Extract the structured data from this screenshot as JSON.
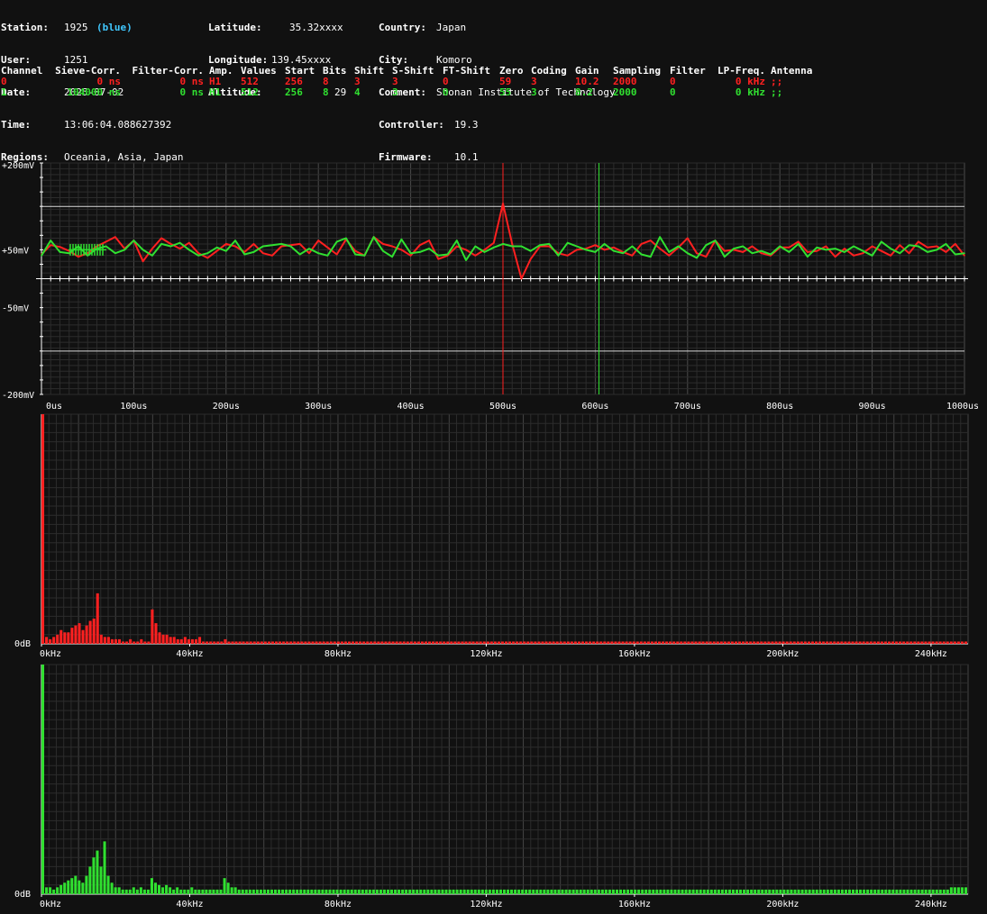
{
  "station_info": {
    "col1": [
      {
        "label": "Station:",
        "value": "1925",
        "extra": "(blue)"
      },
      {
        "label": "User:",
        "value": "1251"
      },
      {
        "label": "Date:",
        "value": "2025-07-02"
      },
      {
        "label": "Time:",
        "value": "13:06:04.088627392"
      },
      {
        "label": "Regions:",
        "value": "Oceania, Asia, Japan"
      }
    ],
    "col2": [
      {
        "label": "Latitude:",
        "value": "35.32xxxx"
      },
      {
        "label": "Longitude:",
        "value": "139.45xxxx"
      },
      {
        "label": "Altitude:",
        "value": "29"
      }
    ],
    "col3": [
      {
        "label": "Country:",
        "value": "Japan"
      },
      {
        "label": "City:",
        "value": "Komoro"
      },
      {
        "label": "Comment:",
        "value": "Shonan Institute of Technology"
      },
      {
        "label": "Controller:",
        "value": "19.3"
      },
      {
        "label": "Firmware:",
        "value": "10.1"
      }
    ]
  },
  "channel_table": {
    "headers": [
      "Channel",
      "Sieve-Corr.",
      "Filter-Corr.",
      "Amp.",
      "Values",
      "Start",
      "Bits",
      "Shift",
      "S-Shift",
      "FT-Shift",
      "Zero",
      "Coding",
      "Gain",
      "Sampling",
      "Filter",
      "LP-Freq.",
      "Antenna"
    ],
    "rows": [
      {
        "color": "#ff2020",
        "cells": [
          "0",
          "0 ns",
          "0 ns",
          "H1",
          "512",
          "256",
          "8",
          "3",
          "3",
          "0",
          "59",
          "3",
          "10.2",
          "2000",
          "0",
          "0 kHz",
          ";;"
        ]
      },
      {
        "color": "#30e030",
        "cells": [
          "1",
          "104000 ns",
          "0 ns",
          "H1",
          "512",
          "256",
          "8",
          "4",
          "3",
          "0",
          "55",
          "3",
          "8.2",
          "2000",
          "0",
          "0 kHz",
          ";;"
        ]
      }
    ]
  },
  "colors": {
    "channel0": "#ff2020",
    "channel1": "#30e030",
    "background": "#111111",
    "grid": "#3a3a3a"
  },
  "chart_data": [
    {
      "type": "line",
      "name": "waveform",
      "x_ticks": [
        "0us",
        "100us",
        "200us",
        "300us",
        "400us",
        "500us",
        "600us",
        "700us",
        "800us",
        "900us",
        "1000us"
      ],
      "y_ticks": [
        "+200mV",
        "+50mV",
        "-50mV",
        "-200mV"
      ],
      "xlim": [
        0,
        1000
      ],
      "ylim": [
        -200,
        200
      ],
      "threshold_mv": [
        125,
        -125
      ],
      "marker_us": [
        {
          "x": 500,
          "channel": 0
        },
        {
          "x": 604,
          "channel": 1
        }
      ],
      "series": [
        {
          "channel": 0,
          "x": [
            0,
            10,
            20,
            30,
            40,
            50,
            60,
            70,
            80,
            90,
            100,
            110,
            120,
            130,
            140,
            150,
            160,
            170,
            180,
            190,
            200,
            210,
            220,
            230,
            240,
            250,
            260,
            270,
            280,
            290,
            300,
            310,
            320,
            330,
            340,
            350,
            360,
            370,
            380,
            390,
            400,
            410,
            420,
            430,
            440,
            450,
            460,
            470,
            480,
            490,
            500,
            510,
            520,
            530,
            540,
            550,
            560,
            570,
            580,
            590,
            600,
            610,
            620,
            630,
            640,
            650,
            660,
            670,
            680,
            690,
            700,
            710,
            720,
            730,
            740,
            750,
            760,
            770,
            780,
            790,
            800,
            810,
            820,
            830,
            840,
            850,
            860,
            870,
            880,
            890,
            900,
            910,
            920,
            930,
            940,
            950,
            960,
            970,
            980,
            990,
            1000
          ],
          "y": [
            42,
            58,
            55,
            48,
            38,
            44,
            56,
            64,
            72,
            52,
            66,
            30,
            52,
            70,
            60,
            52,
            62,
            44,
            36,
            48,
            60,
            56,
            46,
            60,
            44,
            40,
            56,
            58,
            60,
            44,
            66,
            54,
            42,
            68,
            48,
            40,
            72,
            60,
            56,
            50,
            40,
            58,
            66,
            34,
            40,
            56,
            50,
            40,
            50,
            62,
            130,
            60,
            0,
            34,
            56,
            56,
            44,
            40,
            50,
            52,
            58,
            50,
            54,
            46,
            40,
            60,
            66,
            52,
            40,
            54,
            70,
            44,
            38,
            66,
            48,
            50,
            46,
            56,
            44,
            40,
            54,
            54,
            64,
            46,
            48,
            56,
            38,
            52,
            40,
            44,
            56,
            48,
            40,
            58,
            44,
            64,
            54,
            56,
            46,
            60,
            40
          ]
        },
        {
          "channel": 1,
          "x": [
            0,
            10,
            20,
            30,
            40,
            50,
            60,
            70,
            80,
            90,
            100,
            110,
            120,
            130,
            140,
            150,
            160,
            170,
            180,
            190,
            200,
            210,
            220,
            230,
            240,
            250,
            260,
            270,
            280,
            290,
            300,
            310,
            320,
            330,
            340,
            350,
            360,
            370,
            380,
            390,
            400,
            410,
            420,
            430,
            440,
            450,
            460,
            470,
            480,
            490,
            500,
            510,
            520,
            530,
            540,
            550,
            560,
            570,
            580,
            590,
            600,
            610,
            620,
            630,
            640,
            650,
            660,
            670,
            680,
            690,
            700,
            710,
            720,
            730,
            740,
            750,
            760,
            770,
            780,
            790,
            800,
            810,
            820,
            830,
            840,
            850,
            860,
            870,
            880,
            890,
            900,
            910,
            920,
            930,
            940,
            950,
            960,
            970,
            980,
            990,
            1000
          ],
          "y": [
            40,
            66,
            46,
            44,
            56,
            40,
            52,
            56,
            44,
            50,
            66,
            50,
            40,
            60,
            56,
            62,
            50,
            40,
            44,
            54,
            48,
            66,
            42,
            46,
            56,
            58,
            60,
            56,
            42,
            52,
            44,
            40,
            64,
            70,
            42,
            40,
            72,
            48,
            38,
            68,
            44,
            46,
            52,
            40,
            42,
            66,
            32,
            56,
            46,
            54,
            60,
            56,
            56,
            48,
            58,
            60,
            40,
            62,
            56,
            50,
            46,
            60,
            48,
            44,
            56,
            42,
            38,
            72,
            46,
            56,
            44,
            36,
            58,
            66,
            38,
            52,
            56,
            44,
            48,
            42,
            56,
            46,
            60,
            38,
            54,
            50,
            52,
            46,
            56,
            48,
            40,
            64,
            52,
            44,
            58,
            56,
            46,
            50,
            60,
            42,
            44
          ]
        }
      ]
    },
    {
      "type": "bar",
      "name": "spectrum-channel-0",
      "x_ticks": [
        "0kHz",
        "40kHz",
        "80kHz",
        "120kHz",
        "160kHz",
        "200kHz",
        "240kHz"
      ],
      "y_ticks": [
        "0dB"
      ],
      "xlim": [
        0,
        250
      ],
      "ylim": [
        0,
        100
      ],
      "values": [
        100,
        3,
        2,
        3,
        4,
        6,
        5,
        5,
        7,
        8,
        9,
        6,
        8,
        10,
        11,
        22,
        4,
        3,
        3,
        2,
        2,
        2,
        1,
        1,
        2,
        1,
        1,
        2,
        1,
        1,
        15,
        9,
        5,
        4,
        4,
        3,
        3,
        2,
        2,
        3,
        2,
        2,
        2,
        3,
        1,
        1,
        1,
        1,
        1,
        1,
        2,
        1,
        1,
        1,
        1,
        1,
        1,
        1,
        1,
        1,
        1,
        1,
        1,
        1,
        1,
        1,
        1,
        1,
        1,
        1,
        1,
        1,
        1,
        1,
        1,
        1,
        1,
        1,
        1,
        1,
        1,
        1,
        1,
        1,
        1,
        1,
        1,
        1,
        1,
        1,
        1,
        1,
        1,
        1,
        1,
        1,
        1,
        1,
        1,
        1,
        1,
        1,
        1,
        1,
        1,
        1,
        1,
        1,
        1,
        1,
        1,
        1,
        1,
        1,
        1,
        1,
        1,
        1,
        1,
        1,
        1,
        1,
        1,
        1,
        1,
        1,
        1,
        1,
        1,
        1,
        1,
        1,
        1,
        1,
        1,
        1,
        1,
        1,
        1,
        1,
        1,
        1,
        1,
        1,
        1,
        1,
        1,
        1,
        1,
        1,
        1,
        1,
        1,
        1,
        1,
        1,
        1,
        1,
        1,
        1,
        1,
        1,
        1,
        1,
        1,
        1,
        1,
        1,
        1,
        1,
        1,
        1,
        1,
        1,
        1,
        1,
        1,
        1,
        1,
        1,
        1,
        1,
        1,
        1,
        1,
        1,
        1,
        1,
        1,
        1,
        1,
        1,
        1,
        1,
        1,
        1,
        1,
        1,
        1,
        1,
        1,
        1,
        1,
        1,
        1,
        1,
        1,
        1,
        1,
        1,
        1,
        1,
        1,
        1,
        1,
        1,
        1,
        1,
        1,
        1,
        1,
        1,
        1,
        1,
        1,
        1,
        1,
        1,
        1,
        1,
        1,
        1,
        1,
        1,
        1,
        1,
        1,
        1,
        1,
        1,
        1,
        1,
        1,
        1,
        1,
        1,
        1,
        1,
        1,
        1,
        1,
        1,
        1,
        1
      ]
    },
    {
      "type": "bar",
      "name": "spectrum-channel-1",
      "x_ticks": [
        "0kHz",
        "40kHz",
        "80kHz",
        "120kHz",
        "160kHz",
        "200kHz",
        "240kHz"
      ],
      "y_ticks": [
        "0dB"
      ],
      "xlim": [
        0,
        250
      ],
      "ylim": [
        0,
        100
      ],
      "values": [
        100,
        3,
        3,
        2,
        3,
        4,
        5,
        6,
        7,
        8,
        6,
        5,
        8,
        12,
        16,
        19,
        12,
        23,
        8,
        5,
        3,
        3,
        2,
        2,
        2,
        3,
        2,
        3,
        2,
        2,
        7,
        5,
        4,
        3,
        4,
        3,
        2,
        3,
        2,
        2,
        2,
        3,
        2,
        2,
        2,
        2,
        2,
        2,
        2,
        2,
        7,
        5,
        3,
        3,
        2,
        2,
        2,
        2,
        2,
        2,
        2,
        2,
        2,
        2,
        2,
        2,
        2,
        2,
        2,
        2,
        2,
        2,
        2,
        2,
        2,
        2,
        2,
        2,
        2,
        2,
        2,
        2,
        2,
        2,
        2,
        2,
        2,
        2,
        2,
        2,
        2,
        2,
        2,
        2,
        2,
        2,
        2,
        2,
        2,
        2,
        2,
        2,
        2,
        2,
        2,
        2,
        2,
        2,
        2,
        2,
        2,
        2,
        2,
        2,
        2,
        2,
        2,
        2,
        2,
        2,
        2,
        2,
        2,
        2,
        2,
        2,
        2,
        2,
        2,
        2,
        2,
        2,
        2,
        2,
        2,
        2,
        2,
        2,
        2,
        2,
        2,
        2,
        2,
        2,
        2,
        2,
        2,
        2,
        2,
        2,
        2,
        2,
        2,
        2,
        2,
        2,
        2,
        2,
        2,
        2,
        2,
        2,
        2,
        2,
        2,
        2,
        2,
        2,
        2,
        2,
        2,
        2,
        2,
        2,
        2,
        2,
        2,
        2,
        2,
        2,
        2,
        2,
        2,
        2,
        2,
        2,
        2,
        2,
        2,
        2,
        2,
        2,
        2,
        2,
        2,
        2,
        2,
        2,
        2,
        2,
        2,
        2,
        2,
        2,
        2,
        2,
        2,
        2,
        2,
        2,
        2,
        2,
        2,
        2,
        2,
        2,
        2,
        2,
        2,
        2,
        2,
        2,
        2,
        2,
        2,
        2,
        2,
        2,
        2,
        2,
        2,
        2,
        2,
        2,
        2,
        2,
        2,
        2,
        2,
        2,
        2,
        2,
        2,
        2,
        2,
        2,
        2,
        2,
        2,
        2,
        3,
        3,
        3,
        3,
        3
      ]
    }
  ]
}
